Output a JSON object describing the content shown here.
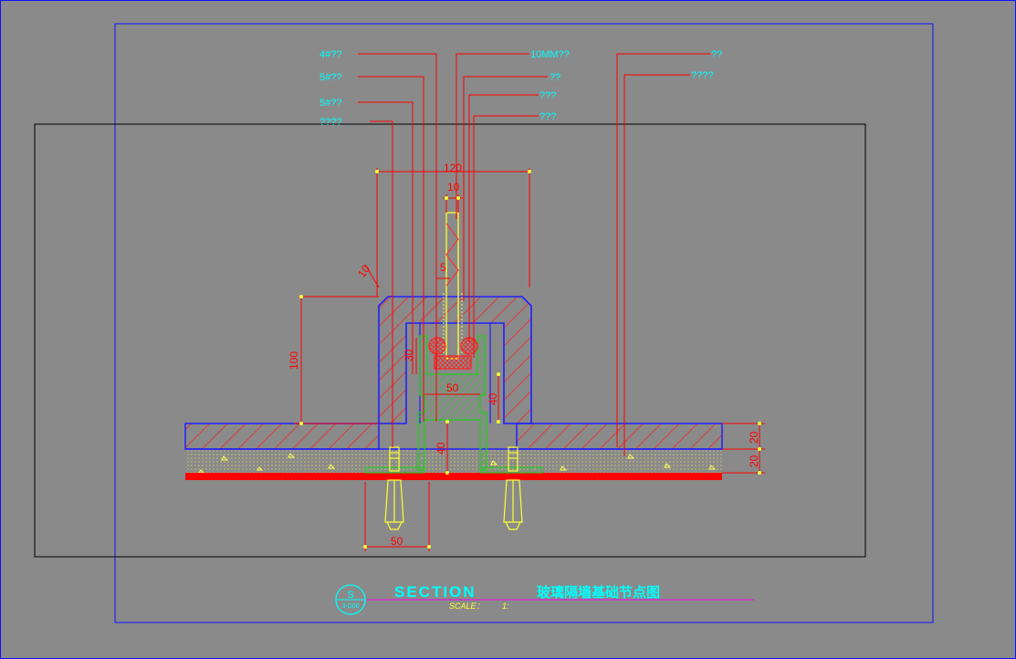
{
  "colors": {
    "background": "#8a8a8a",
    "frame": "#1010ff",
    "inner_frame": "#000000",
    "dimension": "#ff0000",
    "leader_text": "#00ffff",
    "structure": "#2020ff",
    "hatch": "#ff1a1a",
    "channel": "#22cc22",
    "glass": "#ffff33",
    "bolt": "#ffff33",
    "concrete_dots": "#ffff55",
    "base_bar": "#ff0000",
    "title_cyan": "#00ffff",
    "title_underline": "#cc33cc",
    "scale_text": "#ffff33"
  },
  "labels_left": [
    "4#??",
    "5#??",
    "5#??",
    "????"
  ],
  "labels_right": [
    "10MM??",
    "??",
    "???",
    "???",
    "??",
    "????"
  ],
  "dimensions": {
    "width_total": "120",
    "glass_thickness": "10",
    "chamfer": "10",
    "gap": "5",
    "height": "100",
    "setting_block": "30",
    "channel_width": "50",
    "channel_depth": "40",
    "embed_depth": "40",
    "layer_top": "20",
    "layer_bottom": "20",
    "anchor_spacing": "50"
  },
  "title": {
    "badge_letter": "S",
    "badge_sheet": "3-D00",
    "section_word": "SECTION",
    "chinese_title": "玻璃隔墙基础节点图",
    "scale_label": "SCALE：",
    "scale_value": "1:"
  }
}
